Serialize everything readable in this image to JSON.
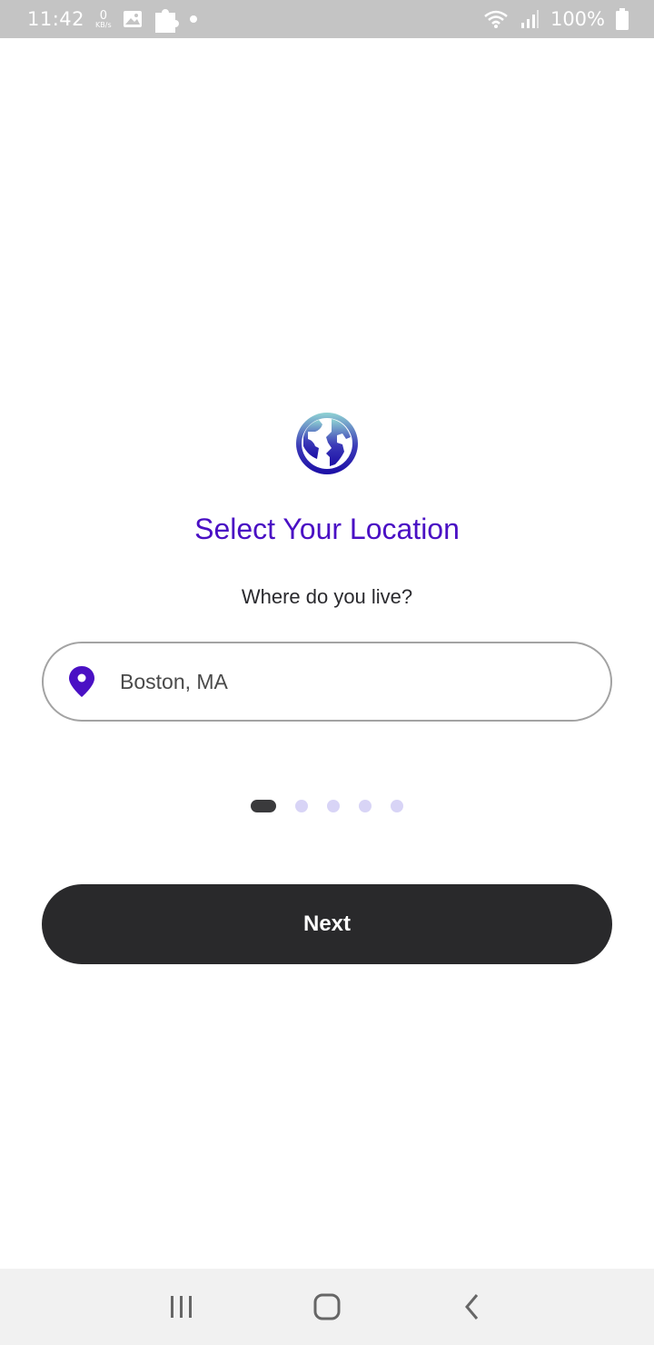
{
  "status_bar": {
    "time": "11:42",
    "net_speed_value": "0",
    "net_speed_unit": "KB/s",
    "battery": "100%",
    "icons": [
      "gallery-icon",
      "puzzle-icon",
      "dot-icon",
      "wifi-icon",
      "signal-icon",
      "battery-icon"
    ]
  },
  "screen": {
    "header_icon": "globe-icon",
    "title": "Select Your Location",
    "subtitle": "Where do you live?",
    "location": {
      "icon": "location-pin-icon",
      "value": "Boston, MA"
    },
    "pagination": {
      "total": 5,
      "current": 1
    },
    "next_label": "Next"
  },
  "nav_bar": {
    "items": [
      "recent-apps-icon",
      "home-icon",
      "back-icon"
    ]
  },
  "colors": {
    "accent": "#4a10c4",
    "button": "#29292b",
    "dot_inactive": "#d8d4f6",
    "dot_active": "#3a3a3c"
  }
}
